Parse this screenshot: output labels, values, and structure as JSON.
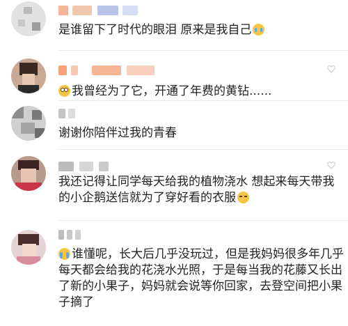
{
  "comments": [
    {
      "text": "是谁留下了时代的眼泪  原来是我自己",
      "trail_emoji": "crying-face-emoji"
    },
    {
      "lead_emoji": "flushed-face-emoji",
      "text": "我曾经为了它，开通了年费的黄钻......"
    },
    {
      "text": "谢谢你陪伴过我的青春"
    },
    {
      "text": "我还记得让同学每天给我的植物浇水  想起来每天带我的小企鹅送信就为了穿好看的衣服",
      "trail_emoji": "squinting-face-emoji"
    },
    {
      "lead_emoji": "loudly-crying-face-emoji",
      "text": "谁懂呢，长大后几乎没玩过，但是我妈妈很多年几乎每天都会给我的花浇水光照，于是每当我的花藤又长出了新的小果子，妈妈就会说等你回家，去登空间把小果子摘了"
    }
  ],
  "colors": {
    "name_tint": "#f4a27a",
    "emoji_yellow": "#f7c443",
    "text": "#222222",
    "divider": "#ececec"
  }
}
